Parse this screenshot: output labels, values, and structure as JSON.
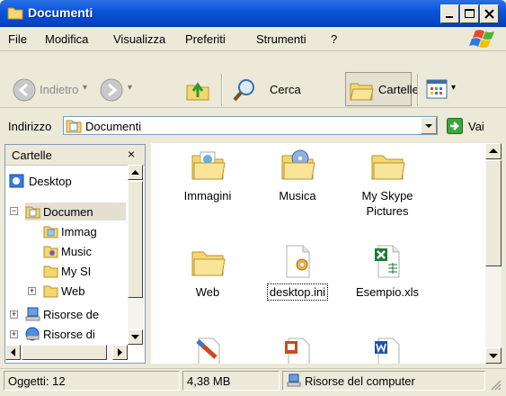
{
  "window": {
    "title": "Documenti"
  },
  "menu": [
    "File",
    "Modifica",
    "Visualizza",
    "Preferiti",
    "Strumenti",
    "?"
  ],
  "toolbar": {
    "back_label": "Indietro",
    "search_label": "Cerca",
    "folders_label": "Cartelle"
  },
  "address": {
    "label": "Indirizzo",
    "value": "Documenti",
    "go_label": "Vai"
  },
  "folder_pane": {
    "title": "Cartelle",
    "close_symbol": "×",
    "tree": [
      {
        "label": "Desktop"
      },
      {
        "label": "Documen",
        "expander": "−"
      },
      {
        "label": "Immag"
      },
      {
        "label": "Music"
      },
      {
        "label": "My SI"
      },
      {
        "label": "Web",
        "expander": "+"
      },
      {
        "label": "Risorse de",
        "expander": "+"
      },
      {
        "label": "Risorse di",
        "expander": "+"
      }
    ]
  },
  "files": [
    {
      "name": "Immagini"
    },
    {
      "name": "Musica"
    },
    {
      "name": "My Skype Pictures"
    },
    {
      "name": "Web"
    },
    {
      "name": "desktop.ini"
    },
    {
      "name": "Esempio.xls"
    }
  ],
  "status": {
    "objects": "Oggetti: 12",
    "size": "4,38 MB",
    "location": "Risorse del computer"
  },
  "colors": {
    "titlebar": "#0b56da",
    "chrome": "#ECE9D8",
    "folder": "#f5d76e",
    "excel": "#1d7a34",
    "word": "#1f4fa8",
    "ppt": "#c84c1c"
  }
}
